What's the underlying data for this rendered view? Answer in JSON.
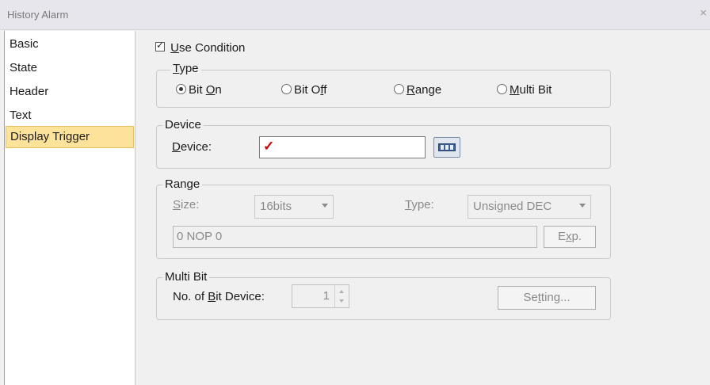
{
  "window": {
    "title": "History Alarm",
    "close_glyph": "×"
  },
  "sidebar": {
    "items": [
      {
        "label": "Basic"
      },
      {
        "label": "State"
      },
      {
        "label": "Header"
      },
      {
        "label": "Text"
      },
      {
        "label": "Display Trigger",
        "selected": true
      }
    ]
  },
  "use_condition": {
    "checked": true,
    "accel": "U",
    "rest": "se Condition"
  },
  "type_group": {
    "legend_accel": "T",
    "legend_rest": "ype",
    "options": [
      {
        "pre": "Bit ",
        "accel": "O",
        "post": "n",
        "selected": true
      },
      {
        "pre": "Bit O",
        "accel": "f",
        "post": "f",
        "selected": false
      },
      {
        "pre": "",
        "accel": "R",
        "post": "ange",
        "selected": false
      },
      {
        "pre": "",
        "accel": "M",
        "post": "ulti Bit",
        "selected": false
      }
    ]
  },
  "device_group": {
    "legend": "Device",
    "label_accel": "D",
    "label_rest": "evice:",
    "value": "",
    "cursor_glyph": "✓",
    "browse_icon": "device-browse-icon"
  },
  "range_group": {
    "legend": "Range",
    "size_label_accel": "S",
    "size_label_rest": "ize:",
    "size_value": "16bits",
    "type_label_accel": "T",
    "type_label_rest": "ype:",
    "type_value": "Unsigned DEC",
    "expression": "0 NOP 0",
    "exp_pre": "E",
    "exp_accel": "x",
    "exp_post": "p."
  },
  "multibit_group": {
    "legend": "Multi Bit",
    "label_pre": "No. of ",
    "label_accel": "B",
    "label_post": "it Device:",
    "count": "1",
    "setting_pre": "Se",
    "setting_accel": "t",
    "setting_post": "ting..."
  },
  "colors": {
    "selected_item_bg": "#fde29a",
    "checkmark_red": "#d00000"
  }
}
